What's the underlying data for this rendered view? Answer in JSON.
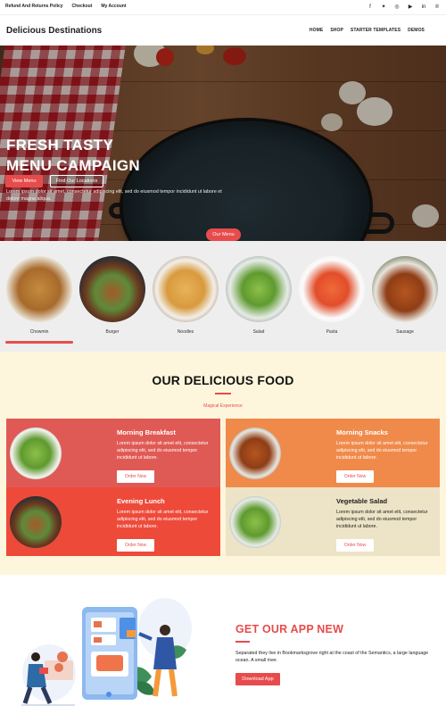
{
  "topbar": {
    "links": [
      "Refund And Returns Policy",
      "Checkout",
      "My Account"
    ],
    "social_icons": [
      "facebook-icon",
      "twitter-icon",
      "instagram-icon",
      "youtube-icon",
      "linkedin-icon",
      "pinterest-icon"
    ]
  },
  "header": {
    "logo": "Delicious Destinations",
    "nav": [
      "HOME",
      "SHOP",
      "STARTER TEMPLATES",
      "DEMOS"
    ]
  },
  "hero": {
    "title_line1": "FRESH TASTY",
    "title_line2": "MENU CAMPAIGN",
    "text": "Lorem ipsum dolor sit amet, consectetur adipiscing elit, sed do eiusmod tempor incididunt ut labore et dolore magna aliqua.",
    "btn_primary": "View Menu",
    "btn_secondary": "Find Our Locations"
  },
  "menu_pill": "Our Menu",
  "gallery": {
    "items": [
      "Chowmin",
      "Burger",
      "Noodles",
      "Salad",
      "Pasta",
      "Sausage"
    ]
  },
  "food": {
    "title": "OUR DELICIOUS FOOD",
    "subtitle": "Magical Experience",
    "cards": [
      {
        "title": "Morning Breakfast",
        "text": "Lorem ipsum dolor sit amet elit, consectetur adipiscing elit, sed do eiusmod tempor incididunt ut labore.",
        "button": "Order Now"
      },
      {
        "title": "Morning Snacks",
        "text": "Lorem ipsum dolor sit amet elit, consectetur adipiscing elit, sed do eiusmod tempor incididunt ut labore.",
        "button": "Order Now"
      },
      {
        "title": "Evening Lunch",
        "text": "Lorem ipsum dolor sit amet elit, consectetur adipiscing elit, sed do eiusmod tempor incididunt ut labore.",
        "button": "Order Now"
      },
      {
        "title": "Vegetable Salad",
        "text": "Lorem ipsum dolor sit amet elit, consectetur adipiscing elit, sed do eiusmod tempor incididunt ut labore.",
        "button": "Order Now"
      }
    ]
  },
  "app": {
    "title": "GET OUR APP NEW",
    "text": "Separated they live in Bookmarksgrove right at the coast of the Semantics, a large language ocean. A small river.",
    "button": "Download App"
  },
  "colors": {
    "accent": "#e74c4c",
    "card_red": "#e05a55",
    "card_orange": "#f08a4b",
    "card_red2": "#ee4a3a",
    "card_beige": "#ede3c6",
    "food_bg": "#fdf6dc"
  }
}
